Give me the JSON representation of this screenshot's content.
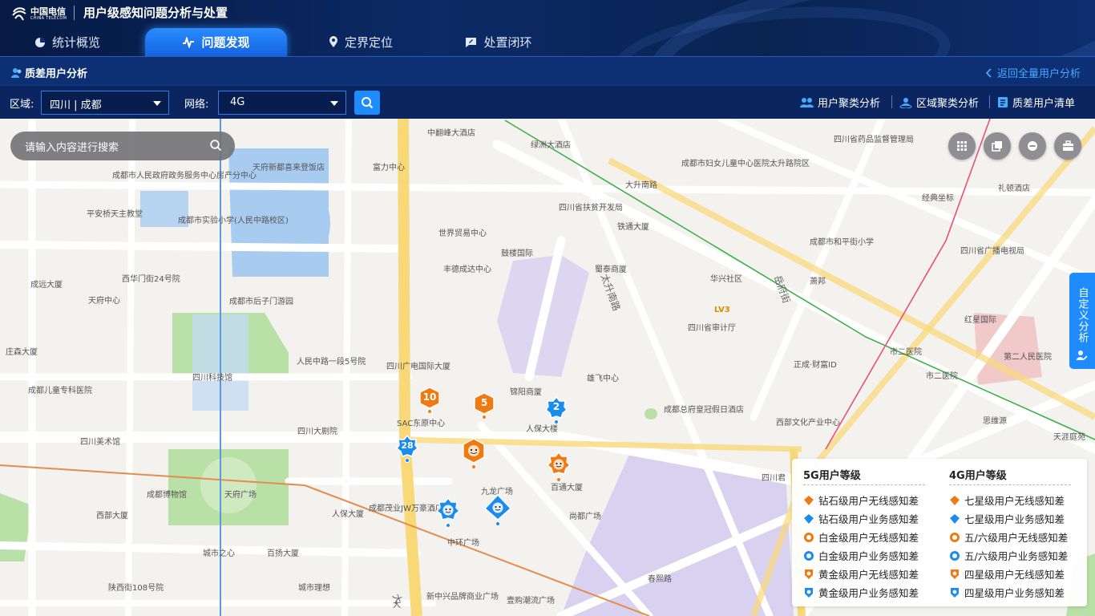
{
  "header": {
    "logo_cn": "中国电信",
    "logo_en": "CHINA TELECOM",
    "title": "用户级感知问题分析与处置",
    "tabs": [
      {
        "label": "统计概览",
        "icon": "chart-pie-icon",
        "active": false
      },
      {
        "label": "问题发现",
        "icon": "pulse-icon",
        "active": true
      },
      {
        "label": "定界定位",
        "icon": "location-pin-icon",
        "active": false
      },
      {
        "label": "处置闭环",
        "icon": "chat-edit-icon",
        "active": false
      }
    ]
  },
  "subbar": {
    "title": "质差用户分析",
    "back_label": "返回全量用户分析"
  },
  "filters": {
    "region_label": "区域:",
    "region_value": "四川 | 成都",
    "network_label": "网络:",
    "network_value": "4G",
    "links": [
      "用户聚类分析",
      "区域聚类分析",
      "质差用户清单"
    ]
  },
  "map": {
    "search_placeholder": "请输入内容进行搜索",
    "side_tab": "自定义分析",
    "markers": [
      {
        "label": "10",
        "kind": "orange-hex"
      },
      {
        "label": "5",
        "kind": "orange-hex"
      },
      {
        "label": "2",
        "kind": "blue-star"
      },
      {
        "label": "28",
        "kind": "blue-star"
      },
      {
        "label": "",
        "kind": "orange-face"
      },
      {
        "label": "",
        "kind": "orange-sun"
      },
      {
        "label": "",
        "kind": "blue-face"
      },
      {
        "label": "",
        "kind": "blue-diamond"
      }
    ],
    "labels": [
      "中翻峰大酒店",
      "绿洲大酒店",
      "成都市妇女儿童中心医院太升路院区",
      "四川省药品监督管理局",
      "天府新都喜来登饭店",
      "富力中心",
      "成都市人民政府政务服务中心房产分中心",
      "大升南路",
      "四川省扶贫开发局",
      "铁通大厦",
      "经典坐标",
      "礼顿酒店",
      "平安桥天主教堂",
      "成都市实验小学(人民中路校区)",
      "世界贸易中心",
      "鼓楼国际",
      "蜀泰商厦",
      "成都市和平街小学",
      "四川省广播电视局",
      "丰德成达中心",
      "西华门街24号院",
      "华兴社区",
      "萧邦",
      "成都市后子门游园",
      "成远大厦",
      "天府中心",
      "LV3",
      "四川省审计厅",
      "红星国际",
      "市二医院",
      "第二人民医院",
      "人民中路一段5号院",
      "四川广电国际大厦",
      "正成·财富ID",
      "四川科技馆",
      "庄森大厦",
      "雄飞中心",
      "市二医院",
      "成都儿童专科医院",
      "锦阳商厦",
      "成都总府皇冠假日酒店",
      "SAC东原中心",
      "人保大楼",
      "西部文化产业中心",
      "思维源",
      "天涯庭苑",
      "四川大剧院",
      "四川美术馆",
      "四川君",
      "成都博物馆",
      "天府广场",
      "九龙广场",
      "百通大厦",
      "西部大厦",
      "人保大厦",
      "成都茂业JW万豪酒店",
      "尚都广场",
      "中环广场",
      "城市之心",
      "百扬大厦",
      "陕西街108号院",
      "城市理想",
      "新中兴品牌商业广场",
      "壹购潮流广场",
      "春熙路",
      "大"
    ],
    "road_labels": [
      "太升南路",
      "岳府街",
      "大"
    ]
  },
  "legend": {
    "col1_title": "5G用户等级",
    "col1": [
      {
        "label": "钻石级用户无线感知差",
        "icon": "diamond-orange-icon"
      },
      {
        "label": "钻石级用户业务感知差",
        "icon": "diamond-blue-icon"
      },
      {
        "label": "白金级用户无线感知差",
        "icon": "platinum-orange-icon"
      },
      {
        "label": "白金级用户业务感知差",
        "icon": "platinum-blue-icon"
      },
      {
        "label": "黄金级用户无线感知差",
        "icon": "gold-orange-icon"
      },
      {
        "label": "黄金级用户业务感知差",
        "icon": "gold-blue-icon"
      }
    ],
    "col2_title": "4G用户等级",
    "col2": [
      {
        "label": "七星级用户无线感知差",
        "icon": "seven-star-orange-icon"
      },
      {
        "label": "七星级用户业务感知差",
        "icon": "seven-star-blue-icon"
      },
      {
        "label": "五/六级用户无线感知差",
        "icon": "five-six-orange-icon"
      },
      {
        "label": "五/六级用户业务感知差",
        "icon": "five-six-blue-icon"
      },
      {
        "label": "四星级用户无线感知差",
        "icon": "four-star-orange-icon"
      },
      {
        "label": "四星级用户业务感知差",
        "icon": "four-star-blue-icon"
      }
    ]
  },
  "colors": {
    "header_bg": "#0b2a66",
    "accent": "#1e8bff",
    "orange": "#f07a12",
    "blue": "#1a8cf0",
    "map_bg": "#f3f2ef"
  }
}
